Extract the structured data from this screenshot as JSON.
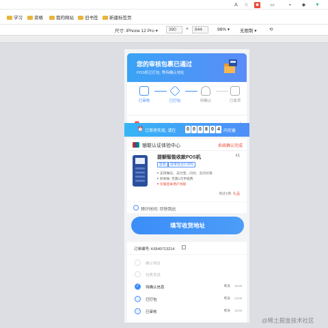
{
  "browser": {
    "toolbar_icons": [
      "read-aloud-icon",
      "immersive-reader-icon",
      "extension-red-icon",
      "sidebar-icon",
      "more-icon",
      "shield-icon",
      "game-icon",
      "vue-devtools-icon"
    ],
    "bookmarks": [
      {
        "label": "学习"
      },
      {
        "label": "资格"
      },
      {
        "label": "我的网站"
      },
      {
        "label": "旧书签"
      },
      {
        "label": "新建标签页"
      }
    ]
  },
  "devtools": {
    "size_label": "尺寸: iPhone 12 Pro",
    "width": "390",
    "times": "×",
    "height": "844",
    "zoom": "98%",
    "throttle": "无限制"
  },
  "page": {
    "hero": {
      "title": "您的审核包裹已通过",
      "subtitle": "POS机已打包, 等待确认地址"
    },
    "steps": [
      {
        "label": "已审核",
        "state": "done",
        "color": "#3b8ef8"
      },
      {
        "label": "已打包",
        "state": "done",
        "color": "#3b8ef8"
      },
      {
        "label": "待确认",
        "state": "pending",
        "color": "#999999"
      },
      {
        "label": "已收货",
        "state": "pending",
        "color": "#999999"
      }
    ],
    "confirm_text": "确认订单并填写地址",
    "confirm_badge": "!",
    "countdown": {
      "prefix": "订单将失效, 请在",
      "digits": [
        "0",
        "0",
        "0",
        "8",
        "0",
        "4"
      ],
      "suffix": "内完善"
    },
    "shop": {
      "name": "银联认证体验中心",
      "status": "系统确认完成"
    },
    "product": {
      "title": "提额智能收款POS机",
      "qty": "x1",
      "tags": [
        "蓝色",
        "费率低至0.38%"
      ],
      "features": [
        "支持微信、支付宝、闪付、云闪付等",
        "秒到账: 无需1元手续费",
        "仅限首单用户领取"
      ],
      "total_label": "共计1件:",
      "total_value": "礼品"
    },
    "eta": "预计时间: 尽快到达",
    "fill_button": "填写收货地址",
    "order_no": "订单编号: K6540713214",
    "timeline": [
      {
        "label": "确认地址",
        "day": "",
        "time": "",
        "active": false
      },
      {
        "label": "包裹发送",
        "day": "",
        "time": "",
        "active": false
      },
      {
        "label": "待确认信息",
        "day": "昨天",
        "time": "15:55",
        "active": true
      },
      {
        "label": "已打包",
        "day": "昨天",
        "time": "14:03",
        "active": true
      },
      {
        "label": "已审核",
        "day": "昨天",
        "time": "13:03",
        "active": true
      }
    ]
  },
  "watermark": "@稀土掘金技术社区"
}
